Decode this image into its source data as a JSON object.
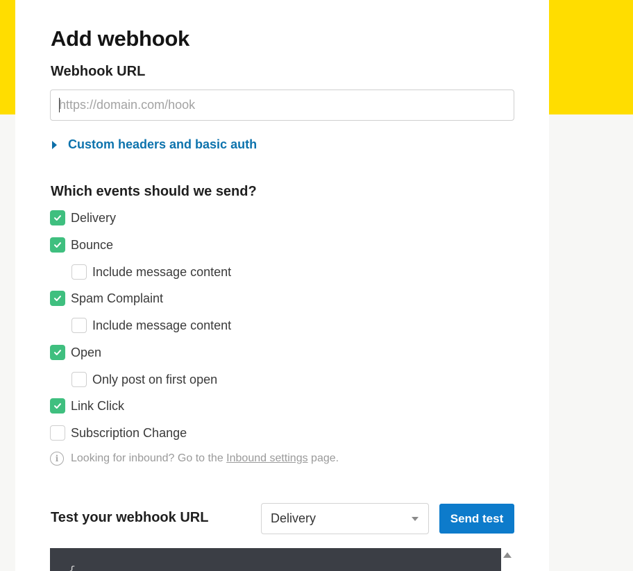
{
  "form": {
    "title": "Add webhook",
    "url_label": "Webhook URL",
    "url_placeholder": "https://domain.com/hook",
    "url_value": "",
    "custom_headers_link": "Custom headers and basic auth"
  },
  "events": {
    "heading": "Which events should we send?",
    "items": [
      {
        "label": "Delivery",
        "checked": true,
        "indent": false
      },
      {
        "label": "Bounce",
        "checked": true,
        "indent": false
      },
      {
        "label": "Include message content",
        "checked": false,
        "indent": true
      },
      {
        "label": "Spam Complaint",
        "checked": true,
        "indent": false
      },
      {
        "label": "Include message content",
        "checked": false,
        "indent": true
      },
      {
        "label": "Open",
        "checked": true,
        "indent": false
      },
      {
        "label": "Only post on first open",
        "checked": false,
        "indent": true
      },
      {
        "label": "Link Click",
        "checked": true,
        "indent": false
      },
      {
        "label": "Subscription Change",
        "checked": false,
        "indent": false
      }
    ]
  },
  "inbound_note": {
    "prefix": "Looking for inbound? Go to the ",
    "link": "Inbound settings",
    "suffix": " page."
  },
  "test": {
    "label": "Test your webhook URL",
    "selected_event": "Delivery",
    "send_button": "Send test",
    "code_preview": "{"
  },
  "colors": {
    "brand_yellow": "#ffdd00",
    "check_green": "#3fbf7f",
    "link_blue": "#0d73ad",
    "button_blue": "#0d7bcb",
    "code_bg": "#3b3e45"
  }
}
